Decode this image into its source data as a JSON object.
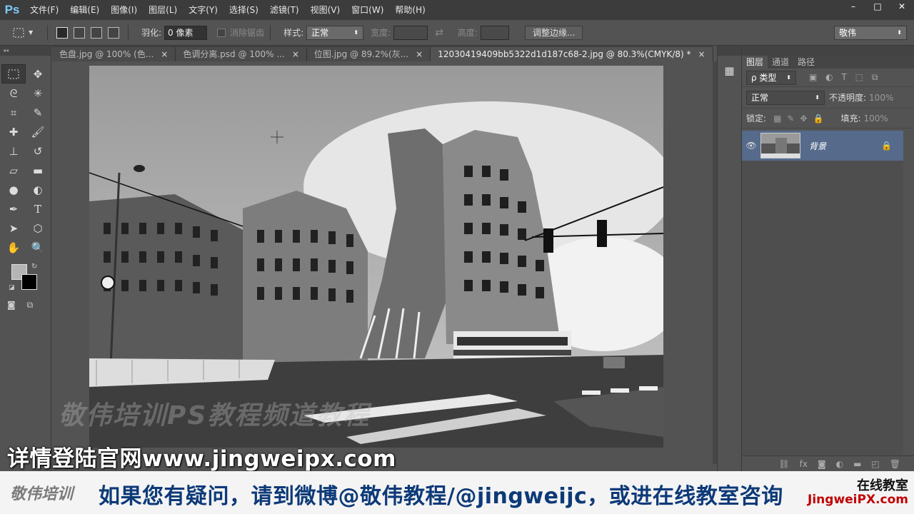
{
  "app": {
    "logo": "Ps"
  },
  "menu": [
    "文件(F)",
    "编辑(E)",
    "图像(I)",
    "图层(L)",
    "文字(Y)",
    "选择(S)",
    "滤镜(T)",
    "视图(V)",
    "窗口(W)",
    "帮助(H)"
  ],
  "window_controls": {
    "minimize": "–",
    "maximize": "□",
    "close": "✕"
  },
  "options": {
    "feather_label": "羽化:",
    "feather_value": "0 像素",
    "antialias_label": "消除锯齿",
    "style_label": "样式:",
    "style_value": "正常",
    "width_label": "宽度:",
    "height_label": "高度:",
    "refine_edge": "调整边缘...",
    "workspace": "敬伟"
  },
  "tabs": [
    {
      "label": "色盘.jpg @ 100% (色...",
      "close": "×"
    },
    {
      "label": "色调分离.psd @ 100% ...",
      "close": "×"
    },
    {
      "label": "位图.jpg @ 89.2%(灰...",
      "close": "×"
    },
    {
      "label": "12030419409bb5322d1d187c68-2.jpg @ 80.3%(CMYK/8) *",
      "close": "×"
    }
  ],
  "colors": {
    "foreground": "#b5b5b5",
    "background": "#000000",
    "layer_selected": "#566b8c",
    "brand_blue": "#0d3a78",
    "brand_red": "#c00000"
  },
  "layers_panel": {
    "tabs": [
      "图层",
      "通道",
      "路径"
    ],
    "filter_label": "ρ 类型",
    "blend_mode": "正常",
    "opacity_label": "不透明度:",
    "opacity_value": "100%",
    "lock_label": "锁定:",
    "fill_label": "填充:",
    "fill_value": "100%",
    "layers": [
      {
        "name": "背景",
        "visible": true,
        "locked": true
      }
    ]
  },
  "overlay": {
    "watermark": "敬伟培训PS教程频道教程",
    "url": "详情登陆官网www.jingweipx.com",
    "bottom_logo": "敬伟培训",
    "bottom_text": "如果您有疑问，请到微博@敬伟教程/@jingweijc，或进在线教室咨询",
    "bottom_right_1": "在线教室",
    "bottom_right_2": "JingweiPX.com"
  }
}
